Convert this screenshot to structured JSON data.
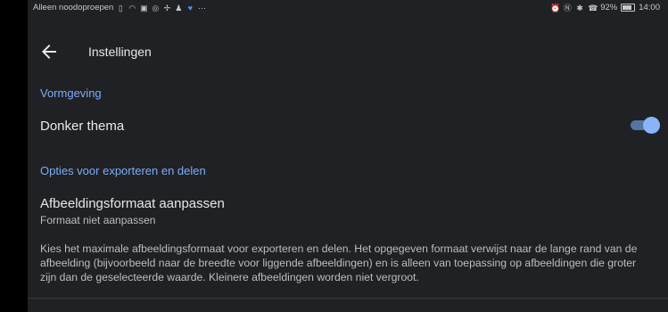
{
  "status_bar": {
    "carrier_text": "Alleen noodoproepen",
    "battery": "92%",
    "time": "14:00"
  },
  "app_bar": {
    "title": "Instellingen"
  },
  "sections": [
    {
      "header": "Vormgeving",
      "items": [
        {
          "title": "Donker thema",
          "toggle_on": true
        }
      ]
    },
    {
      "header": "Opties voor exporteren en delen",
      "items": [
        {
          "title": "Afbeeldingsformaat aanpassen",
          "subtitle": "Formaat niet aanpassen",
          "description": "Kies het maximale afbeeldingsformaat voor exporteren en delen. Het opgegeven formaat verwijst naar de lange rand van de afbeelding (bijvoorbeeld naar de breedte voor liggende afbeeldingen) en is alleen van toepassing op afbeeldingen die groter zijn dan de geselecteerde waarde. Kleinere afbeeldingen worden niet vergroot."
        }
      ]
    }
  ],
  "colors": {
    "background": "#202124",
    "accent": "#7cacf8",
    "primary_text": "#e8e8e8",
    "secondary_text": "#bdbdbd"
  }
}
